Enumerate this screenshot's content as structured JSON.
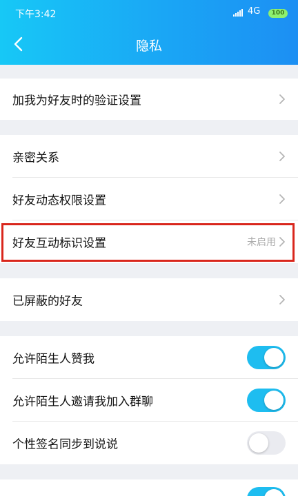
{
  "status_bar": {
    "time": "下午3:42",
    "network": "4G",
    "battery": "100"
  },
  "nav": {
    "title": "隐私"
  },
  "sections": {
    "verify": {
      "label": "加我为好友时的验证设置"
    },
    "intimate": {
      "label": "亲密关系"
    },
    "moments_permission": {
      "label": "好友动态权限设置"
    },
    "interaction_badge": {
      "label": "好友互动标识设置",
      "value": "未启用"
    },
    "blocked": {
      "label": "已屏蔽的好友"
    },
    "stranger_like": {
      "label": "允许陌生人赞我",
      "enabled": true
    },
    "stranger_invite": {
      "label": "允许陌生人邀请我加入群聊",
      "enabled": true
    },
    "signature_sync": {
      "label": "个性签名同步到说说",
      "enabled": false
    }
  },
  "colors": {
    "accent": "#1ebdf0",
    "highlight": "#d9261c"
  }
}
